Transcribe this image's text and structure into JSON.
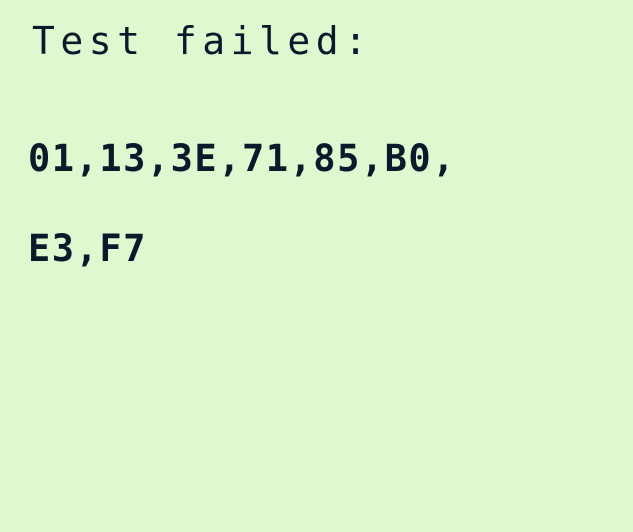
{
  "screen": {
    "title": "Test failed:",
    "result_lines": [
      "01,13,3E,71,85,B0,",
      "E3,F7"
    ]
  },
  "colors": {
    "background": "#e0f8d0",
    "foreground": "#0a1a2b"
  }
}
